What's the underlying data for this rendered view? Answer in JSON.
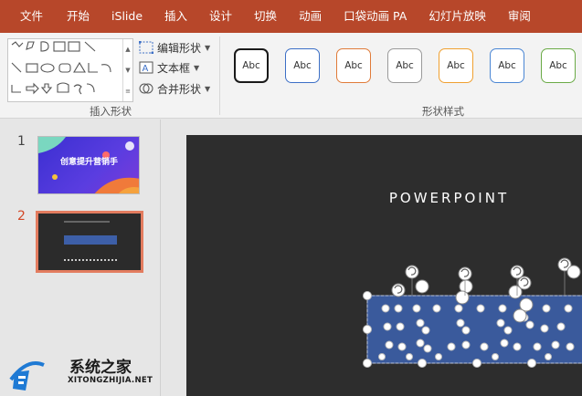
{
  "ribbon_tabs": [
    "文件",
    "开始",
    "iSlide",
    "插入",
    "设计",
    "切换",
    "动画",
    "口袋动画 PA",
    "幻灯片放映",
    "审阅"
  ],
  "shape_commands": {
    "edit_shape": "编辑形状",
    "text_box": "文本框",
    "merge_shapes": "合并形状"
  },
  "group_labels": {
    "insert_shapes": "插入形状",
    "shape_styles": "形状样式"
  },
  "style_presets": [
    {
      "label": "Abc",
      "color": "#1a1a1a"
    },
    {
      "label": "Abc",
      "color": "#3c6fc6"
    },
    {
      "label": "Abc",
      "color": "#e07b39"
    },
    {
      "label": "Abc",
      "color": "#9a9a9a"
    },
    {
      "label": "Abc",
      "color": "#f0a030"
    },
    {
      "label": "Abc",
      "color": "#4a86d4"
    },
    {
      "label": "Abc",
      "color": "#6aaa46"
    }
  ],
  "slides": [
    {
      "number": "1",
      "title": "创意提升营销手"
    },
    {
      "number": "2"
    }
  ],
  "slide_title": "POWERPOINT",
  "watermark": {
    "name": "系统之家",
    "url": "XITONGZHIJIA.NET"
  },
  "colors": {
    "accent": "#b7472a",
    "selected_thumb_border": "#e37c5f",
    "selection_fill": "#3a5a9c"
  }
}
